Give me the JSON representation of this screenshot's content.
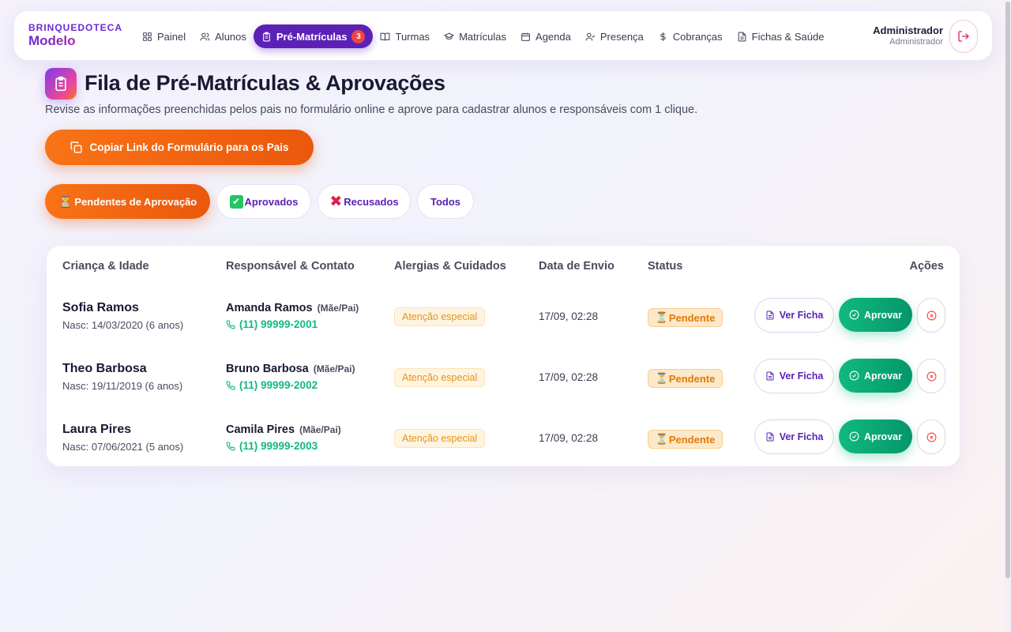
{
  "brand": {
    "line1": "BRINQUEDOTECA",
    "line2": "Modelo"
  },
  "nav": {
    "items": [
      {
        "label": "Painel",
        "icon": "grid-icon"
      },
      {
        "label": "Alunos",
        "icon": "users-icon"
      },
      {
        "label": "Pré-Matrículas",
        "icon": "clipboard-icon",
        "badge": "3",
        "active": true
      },
      {
        "label": "Turmas",
        "icon": "book-open-icon"
      },
      {
        "label": "Matrículas",
        "icon": "graduation-cap-icon"
      },
      {
        "label": "Agenda",
        "icon": "calendar-icon"
      },
      {
        "label": "Presença",
        "icon": "user-check-icon"
      },
      {
        "label": "Cobranças",
        "icon": "dollar-icon"
      },
      {
        "label": "Fichas & Saúde",
        "icon": "file-text-icon"
      }
    ]
  },
  "user": {
    "name": "Administrador",
    "role": "Administrador",
    "logout_icon": "logout-icon"
  },
  "header": {
    "title": "Fila de Pré-Matrículas & Aprovações",
    "subtitle": "Revise as informações preenchidas pelos pais no formulário online e aprove para cadastrar alunos e responsáveis com 1 clique.",
    "copy_link_label": "Copiar Link do Formulário para os Pais"
  },
  "filters": [
    {
      "emoji": "⏳",
      "label": "Pendentes de Aprovação",
      "active": true
    },
    {
      "emoji": "✔",
      "label": "Aprovados"
    },
    {
      "emoji": "✖",
      "label": "Recusados"
    },
    {
      "emoji": "",
      "label": "Todos"
    }
  ],
  "table": {
    "headers": {
      "child": "Criança & Idade",
      "guardian": "Responsável & Contato",
      "allergies": "Alergias & Cuidados",
      "sent": "Data de Envio",
      "status": "Status",
      "actions": "Ações"
    },
    "rows": [
      {
        "child_name": "Sofia Ramos",
        "birth": "Nasc: 14/03/2020 (6 anos)",
        "guardian_name": "Amanda Ramos",
        "relation": "(Mãe/Pai)",
        "phone": "(11) 99999-2001",
        "allergy": "Atenção especial",
        "sent": "17/09, 02:28",
        "status": "Pendente"
      },
      {
        "child_name": "Theo Barbosa",
        "birth": "Nasc: 19/11/2019 (6 anos)",
        "guardian_name": "Bruno Barbosa",
        "relation": "(Mãe/Pai)",
        "phone": "(11) 99999-2002",
        "allergy": "Atenção especial",
        "sent": "17/09, 02:28",
        "status": "Pendente"
      },
      {
        "child_name": "Laura Pires",
        "birth": "Nasc: 07/06/2021 (5 anos)",
        "guardian_name": "Camila Pires",
        "relation": "(Mãe/Pai)",
        "phone": "(11) 99999-2003",
        "allergy": "Atenção especial",
        "sent": "17/09, 02:28",
        "status": "Pendente"
      }
    ],
    "actions": {
      "view": "Ver Ficha",
      "approve": "Aprovar"
    }
  },
  "colors": {
    "primary": "#5b21b6",
    "accent_orange": "#f97316",
    "success": "#10b981",
    "danger": "#ef4444",
    "warning": "#e69517"
  }
}
